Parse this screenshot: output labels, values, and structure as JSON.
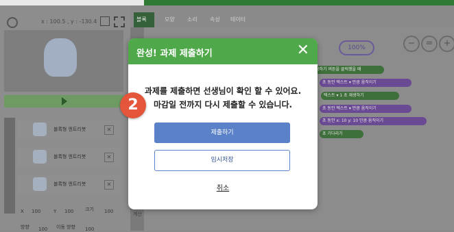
{
  "stage_panel": {
    "coords": "x : 100.5 , y : -130.4"
  },
  "tabs": [
    "블록",
    "모양",
    "소리",
    "속성",
    "테이터"
  ],
  "zoom": "100%",
  "blocks": [
    "작하기 버튼을 클릭했을 때",
    "초 동안  텍스트 ▾  만큼 움직이기",
    "텍스트 ▾  1  초 재생하기",
    "초 동안  텍스트 ▾  만큼 움직이기",
    "초 동안 x:  10  y:  10  만큼 움직이기",
    "초 기다리기"
  ],
  "object_list": [
    {
      "name": "블록형 엔트리봇"
    },
    {
      "name": "블록형 엔트리봇"
    },
    {
      "name": "블록형 엔트리봇"
    }
  ],
  "properties": {
    "x_label": "X",
    "x_value": "100",
    "y_label": "Y",
    "y_value": "100",
    "size_label": "크기",
    "size_value": "100",
    "dir_label": "방향",
    "dir_value": "100",
    "move_dir_label": "이동 방향",
    "move_dir_value": "100"
  },
  "palette_bottom": "계산",
  "modal": {
    "title": "완성! 과제 제출하기",
    "close_symbol": "✕",
    "message_line1": "과제를 제출하면 선생님이 확인 할 수 있어요.",
    "message_line2": "마감일 전까지 다시 제출할 수 있습니다.",
    "submit_label": "제출하기",
    "temp_save_label": "임시저장",
    "cancel_label": "취소"
  },
  "step_marker": "2",
  "colors": {
    "modal_header": "#4fa84a",
    "primary_button": "#5b82c9",
    "step_marker": "#e4553b"
  }
}
